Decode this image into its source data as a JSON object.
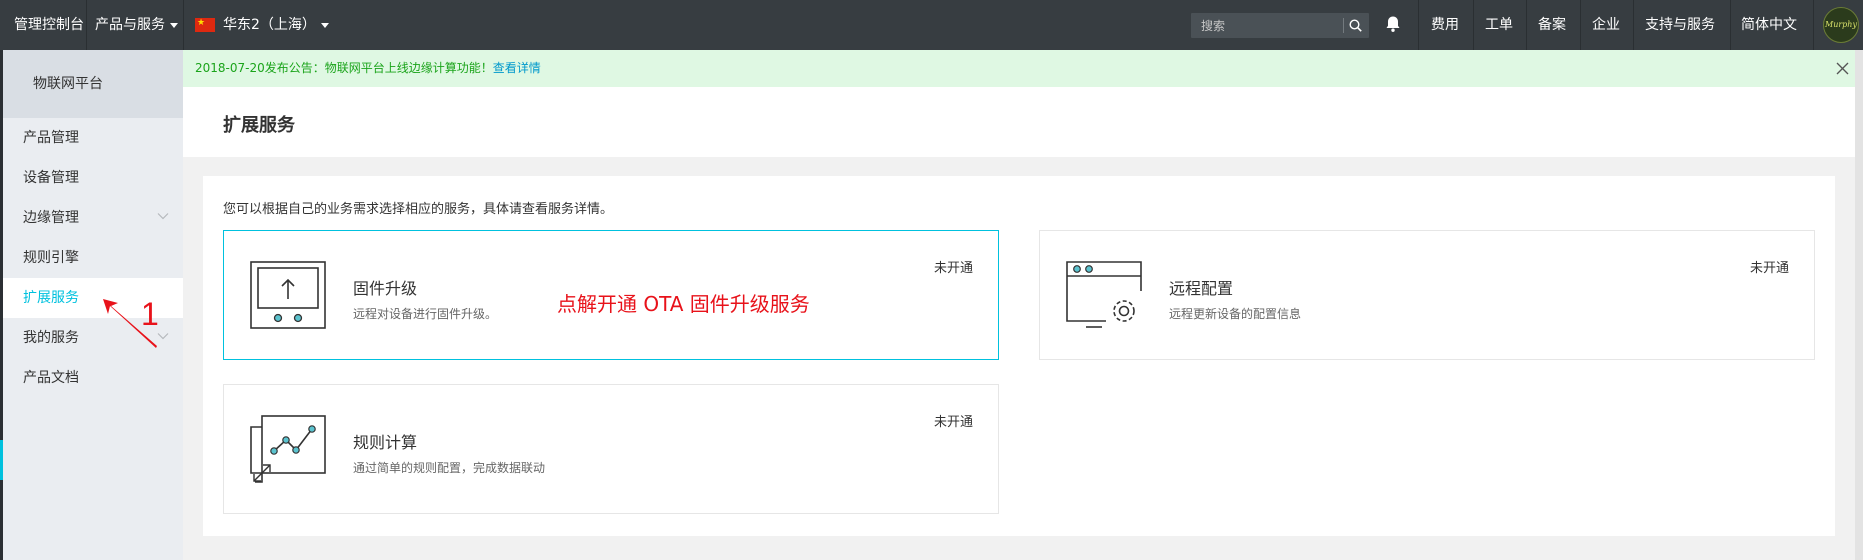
{
  "topbar": {
    "console": "管理控制台",
    "products": "产品与服务",
    "region": "华东2（上海）",
    "search_placeholder": "搜索",
    "links": [
      "费用",
      "工单",
      "备案",
      "企业",
      "支持与服务",
      "简体中文"
    ],
    "avatar_text": "Murphy"
  },
  "sidebar": {
    "title": "物联网平台",
    "items": [
      {
        "label": "产品管理"
      },
      {
        "label": "设备管理"
      },
      {
        "label": "边缘管理"
      },
      {
        "label": "规则引擎"
      },
      {
        "label": "扩展服务"
      },
      {
        "label": "我的服务"
      },
      {
        "label": "产品文档"
      }
    ]
  },
  "notice": {
    "text": "2018-07-20发布公告：物联网平台上线边缘计算功能！",
    "link": "查看详情"
  },
  "page": {
    "title": "扩展服务",
    "description": "您可以根据自己的业务需求选择相应的服务，具体请查看服务详情。"
  },
  "services": [
    {
      "title": "固件升级",
      "subtitle": "远程对设备进行固件升级。",
      "status": "未开通"
    },
    {
      "title": "远程配置",
      "subtitle": "远程更新设备的配置信息",
      "status": "未开通"
    },
    {
      "title": "规则计算",
      "subtitle": "通过简单的规则配置，完成数据联动",
      "status": "未开通"
    }
  ],
  "annotation": {
    "text": "点解开通 OTA 固件升级服务",
    "number": "1"
  },
  "colors": {
    "topbar_bg": "#373d41",
    "accent": "#00c1de",
    "annotation_red": "#e8121a",
    "notice_green": "#1ba41b"
  }
}
